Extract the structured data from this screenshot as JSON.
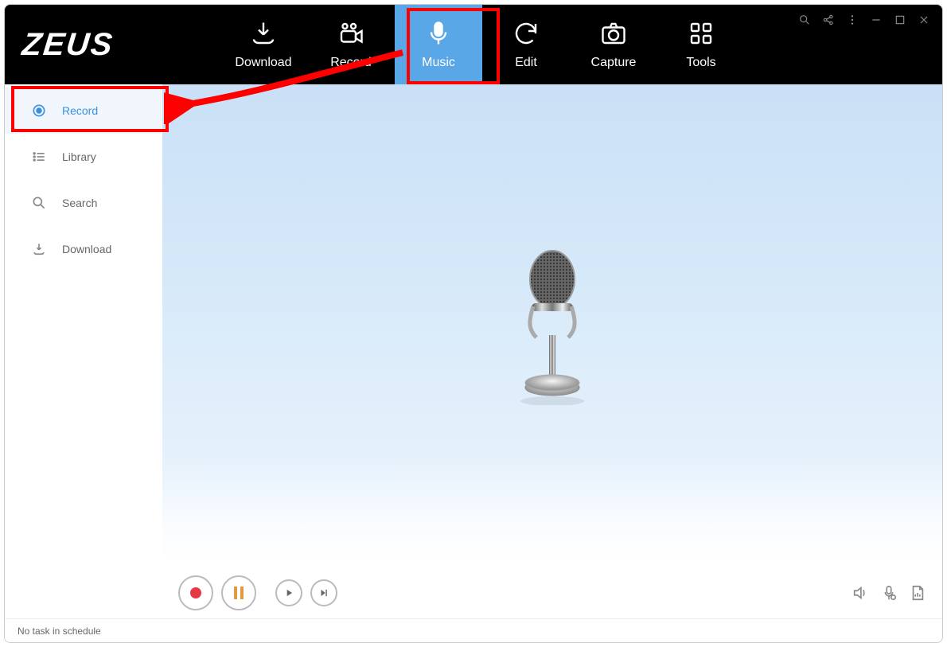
{
  "app": {
    "logo_text": "ZEUS"
  },
  "tabs": {
    "download": "Download",
    "record": "Record",
    "music": "Music",
    "edit": "Edit",
    "capture": "Capture",
    "tools": "Tools"
  },
  "sidebar": {
    "record": "Record",
    "library": "Library",
    "search": "Search",
    "download": "Download"
  },
  "status": {
    "text": "No task in schedule"
  }
}
